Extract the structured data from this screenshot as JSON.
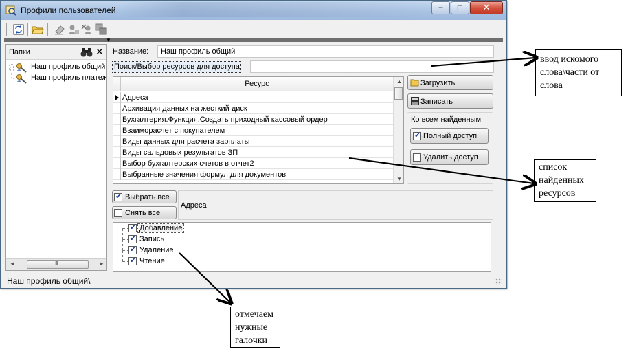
{
  "window": {
    "title": "Профили пользователей",
    "controls": {
      "minimize": "−",
      "maximize": "□",
      "close": "✕"
    }
  },
  "toolbar": {
    "icons": [
      "refresh-icon",
      "open-folder-icon",
      "eraser-icon",
      "user-edit-icon",
      "user-remove-icon",
      "windows-icon"
    ]
  },
  "folders": {
    "title": "Папки",
    "search_icon": "binoculars-icon",
    "close": "✕",
    "items": [
      {
        "label": "Наш профиль общий"
      },
      {
        "label": "Наш профиль платежи"
      }
    ],
    "scroll_left": "◄",
    "scroll_right": "►",
    "scroll_thumb": "III"
  },
  "profile": {
    "name_label": "Название:",
    "name_value": "Наш профиль общий",
    "search_label": "Поиск/Выбор ресурсов для доступа",
    "search_value": ""
  },
  "resources": {
    "column": "Ресурс",
    "rows": [
      "Адреса",
      "Архивация данных на жесткий диск",
      "Бухгалтерия.Функция.Создать приходный кассовый ордер",
      "Взаиморасчет с покупателем",
      "Виды данных для расчета зарплаты",
      "Виды сальдовых результатов ЗП",
      "Выбор бухгалтерских счетов в отчет2",
      "Выбранные значения формул для документов"
    ],
    "current_row": 0,
    "scroll_up": "▲",
    "scroll_down": "▼"
  },
  "actions": {
    "load": "Загрузить",
    "save": "Записать",
    "group_title": "Ко всем найденным",
    "full_access": "Полный доступ",
    "full_access_checked": true,
    "remove_access": "Удалить доступ",
    "remove_access_checked": false
  },
  "selection": {
    "select_all": "Выбрать все",
    "select_all_checked": true,
    "deselect_all": "Снять все",
    "deselect_all_checked": false,
    "current_resource": "Адреса"
  },
  "rights": [
    {
      "label": "Добавление",
      "checked": true
    },
    {
      "label": "Запись",
      "checked": true
    },
    {
      "label": "Удаление",
      "checked": true
    },
    {
      "label": "Чтение",
      "checked": true
    }
  ],
  "status": {
    "text": "Наш профиль общий\\"
  },
  "annotations": {
    "search_note": [
      "ввод искомого",
      "слова\\части от",
      "слова"
    ],
    "list_note": [
      "список",
      "найденных",
      "ресурсов"
    ],
    "checks_note": [
      "отмечаем",
      "нужные",
      "галочки"
    ]
  }
}
